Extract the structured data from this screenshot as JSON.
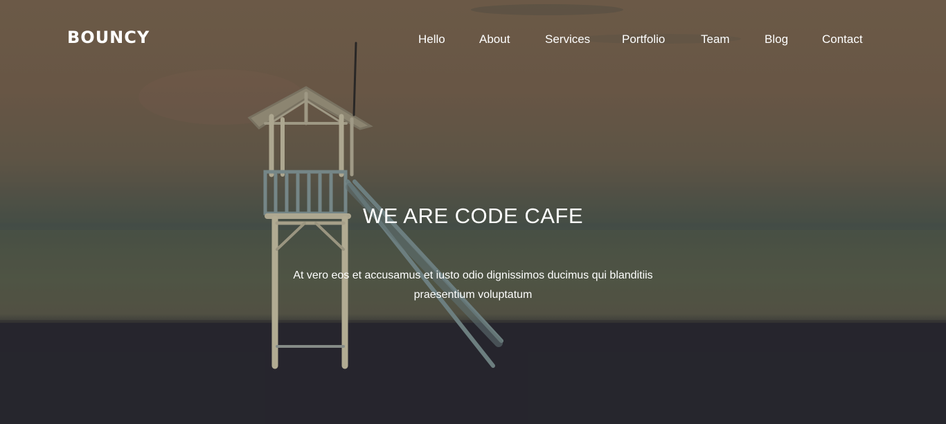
{
  "brand": {
    "name": "BOUNCY"
  },
  "nav": {
    "items": [
      {
        "label": "Hello"
      },
      {
        "label": "About"
      },
      {
        "label": "Services"
      },
      {
        "label": "Portfolio"
      },
      {
        "label": "Team"
      },
      {
        "label": "Blog"
      },
      {
        "label": "Contact"
      }
    ]
  },
  "hero": {
    "title": "WE ARE CODE CAFE",
    "text_line1": "At vero eos et accusamus et iusto odio dignissimos ducimus qui blanditiis",
    "text_line2": "praesentium voluptatum",
    "background_image": "lifeguard-tower-beach-dusk"
  },
  "colors": {
    "text": "#ffffff",
    "sky": "#7e6a52",
    "sea": "#55604f",
    "sand": "#2b2a33"
  }
}
